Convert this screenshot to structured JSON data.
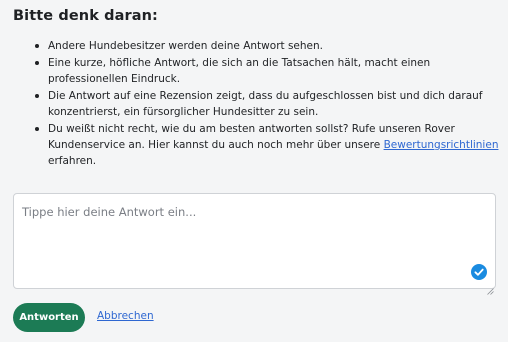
{
  "notice": {
    "title": "Bitte denk daran:",
    "tips": [
      {
        "text": "Andere Hundebesitzer werden deine Antwort sehen."
      },
      {
        "text": "Eine kurze, höfliche Antwort, die sich an die Tatsachen hält, macht einen professionellen Eindruck."
      },
      {
        "text": "Die Antwort auf eine Rezension zeigt, dass du aufgeschlossen bist und dich darauf konzentrierst, ein fürsorglicher Hundesitter zu sein."
      },
      {
        "text_before": "Du weißt nicht recht, wie du am besten antworten sollst? Rufe unseren Rover Kundenservice an. Hier kannst du auch noch mehr über unsere ",
        "link_text": "Bewertungsrichtlinien",
        "text_after": " erfahren."
      }
    ]
  },
  "reply": {
    "placeholder": "Tippe hier deine Antwort ein...",
    "value": ""
  },
  "actions": {
    "submit_label": "Antworten",
    "cancel_label": "Abbrechen"
  },
  "colors": {
    "primary_button": "#1c7b55",
    "link": "#2e67d1",
    "check_badge": "#1a8be0",
    "background": "#f4f5f6"
  },
  "icons": {
    "field_badge": "check-circle-icon",
    "textarea_resize": "resize-handle-icon"
  }
}
